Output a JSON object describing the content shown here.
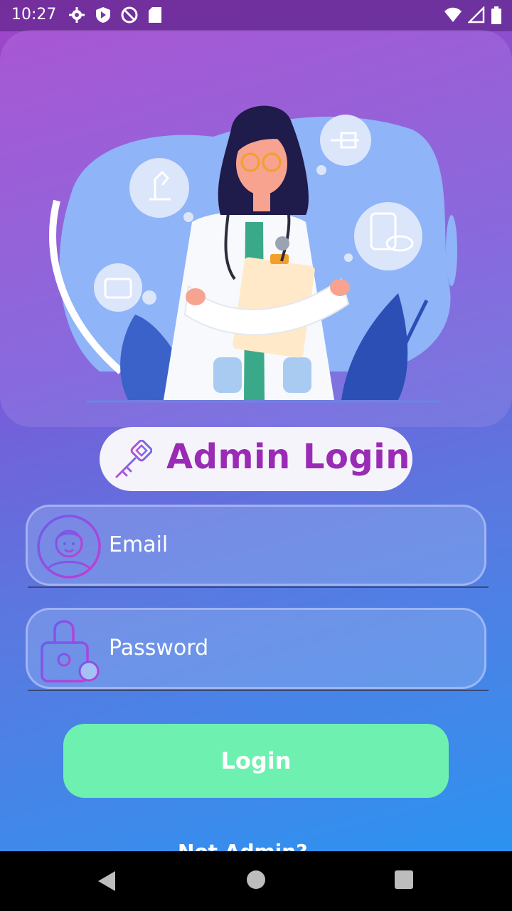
{
  "status_bar": {
    "time": "10:27"
  },
  "header": {
    "title": "Admin Login"
  },
  "form": {
    "email": {
      "placeholder": "Email"
    },
    "password": {
      "placeholder": "Password"
    }
  },
  "actions": {
    "login_label": "Login"
  },
  "footer": {
    "partial_link": "Not Admin?"
  },
  "colors": {
    "title": "#9a2bb5",
    "login_button": "#6df0b0",
    "pill_background": "#f6f4fb"
  }
}
